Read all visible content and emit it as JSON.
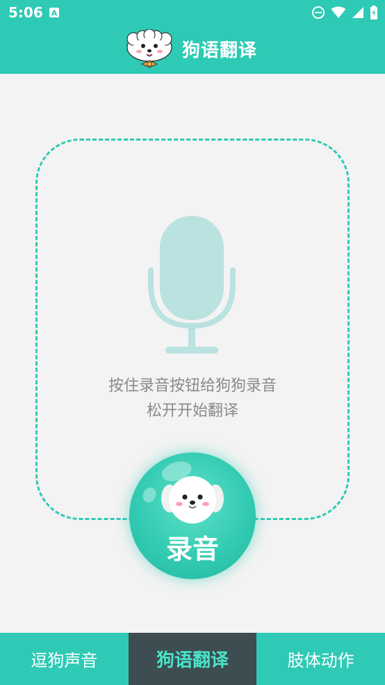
{
  "status_bar": {
    "time": "5:06",
    "icons": [
      "notification-a-icon",
      "do-not-disturb-icon",
      "wifi-icon",
      "signal-icon",
      "battery-icon"
    ]
  },
  "app_bar": {
    "title": "狗语翻译",
    "logo": "dog-face-logo"
  },
  "main": {
    "hint_line1": "按住录音按钮给狗狗录音",
    "hint_line2": "松开开始翻译",
    "record_button_label": "录音"
  },
  "tabs": [
    {
      "label": "逗狗声音",
      "active": false
    },
    {
      "label": "狗语翻译",
      "active": true
    },
    {
      "label": "肢体动作",
      "active": false
    }
  ],
  "colors": {
    "accent": "#2ecab5",
    "active_tab_bg": "#3d4d51",
    "active_tab_text": "#49e4c9",
    "mic": "#b9e2e0",
    "hint_text": "#8a8a8a"
  }
}
